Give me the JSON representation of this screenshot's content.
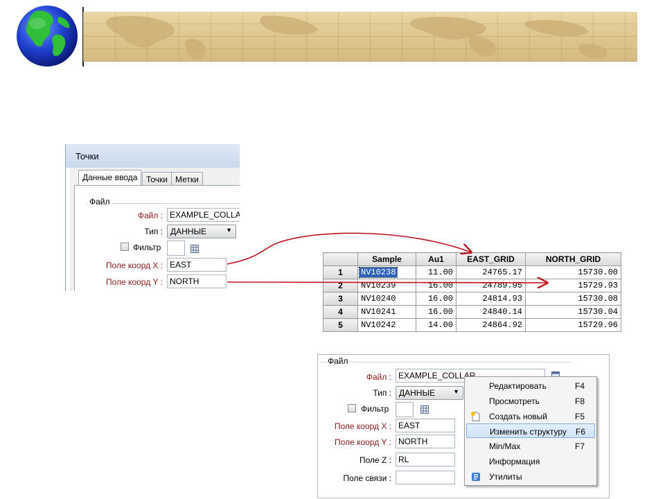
{
  "dialog_points": {
    "title": "Точки",
    "tabs": [
      {
        "label": "Данные ввода",
        "active": true
      },
      {
        "label": "Точки",
        "active": false
      },
      {
        "label": "Метки",
        "active": false
      }
    ],
    "group_title": "Файл",
    "file_label": "Файл :",
    "file_value": "EXAMPLE_COLLAR",
    "type_label": "Тип :",
    "type_value": "ДАННЫЕ",
    "filter_label": "Фильтр",
    "x_field_label": "Поле коорд X :",
    "x_field_value": "EAST",
    "y_field_label": "Поле коорд Y :",
    "y_field_value": "NORTH"
  },
  "data_table": {
    "columns": [
      "",
      "Sample",
      "Au1",
      "EAST_GRID",
      "NORTH_GRID"
    ],
    "rows": [
      {
        "n": "1",
        "sample": "NV10238",
        "au1": "11.00",
        "east": "24765.17",
        "north": "15730.00"
      },
      {
        "n": "2",
        "sample": "NV10239",
        "au1": "16.00",
        "east": "24789.95",
        "north": "15729.93"
      },
      {
        "n": "3",
        "sample": "NV10240",
        "au1": "16.00",
        "east": "24814.93",
        "north": "15730.08"
      },
      {
        "n": "4",
        "sample": "NV10241",
        "au1": "16.00",
        "east": "24840.14",
        "north": "15730.04"
      },
      {
        "n": "5",
        "sample": "NV10242",
        "au1": "14.00",
        "east": "24864.92",
        "north": "15729.96"
      }
    ]
  },
  "dialog_file": {
    "group_title": "Файл",
    "file_label": "Файл :",
    "file_value": "EXAMPLE_COLLAR",
    "type_label": "Тип :",
    "type_value": "ДАННЫЕ",
    "filter_label": "Фильтр",
    "x_field_label": "Поле коорд X :",
    "x_field_value": "EAST",
    "y_field_label": "Поле коорд Y :",
    "y_field_value": "NORTH",
    "z_field_label": "Поле Z :",
    "z_field_value": "RL",
    "link_field_label": "Поле связи :",
    "link_field_value": ""
  },
  "context_menu": {
    "items": [
      {
        "label": "Редактировать",
        "key": "F4",
        "icon": ""
      },
      {
        "label": "Просмотреть",
        "key": "F8",
        "icon": ""
      },
      {
        "label": "Создать новый",
        "key": "F5",
        "icon": "new-file-icon"
      },
      {
        "label": "Изменить структуру",
        "key": "F6",
        "icon": "",
        "highlighted": true
      },
      {
        "label": "Min/Max",
        "key": "F7",
        "icon": ""
      },
      {
        "label": "Информация",
        "key": "",
        "icon": ""
      },
      {
        "label": "Утилиты",
        "key": "",
        "icon": "utilities-icon"
      }
    ]
  },
  "colors": {
    "field_label_red": "#8b1a1a",
    "arrow_red": "#c0141e",
    "selection_blue": "#2b62b8",
    "menu_highlight": "#cfe2f7"
  }
}
